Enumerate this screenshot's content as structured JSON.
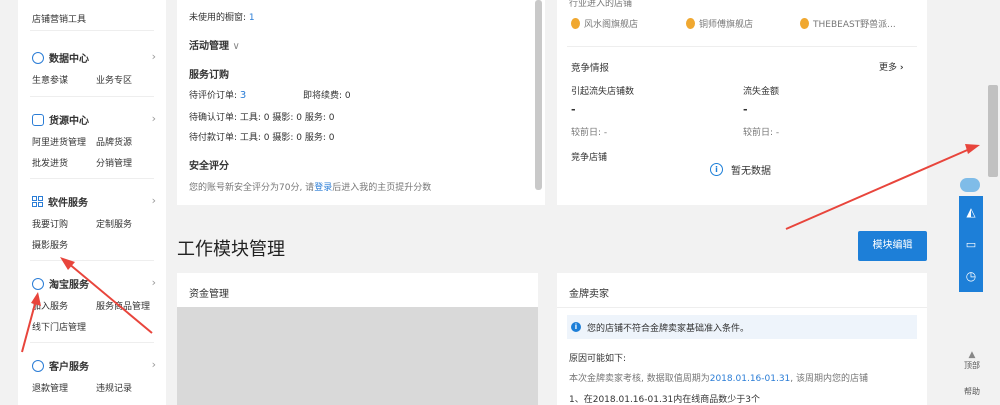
{
  "sidebar": {
    "top_item": "店铺营销工具",
    "sections": [
      {
        "title": "数据中心",
        "links": [
          "生意参谋",
          "业务专区"
        ]
      },
      {
        "title": "货源中心",
        "links": [
          "阿里进货管理",
          "品牌货源",
          "批发进货",
          "分销管理"
        ]
      },
      {
        "title": "软件服务",
        "links": [
          "我要订购",
          "定制服务",
          "摄影服务"
        ]
      },
      {
        "title": "淘宝服务",
        "links": [
          "加入服务",
          "服务商品管理",
          "线下门店管理"
        ]
      },
      {
        "title": "客户服务",
        "links": [
          "退款管理",
          "违规记录"
        ]
      }
    ]
  },
  "left_panel": {
    "unused_window": "未使用的橱窗:",
    "unused_window_count": "1",
    "activity": "活动管理",
    "service_order": "服务订购",
    "pending_review": "待评价订单:",
    "pending_review_count": "3",
    "expiring": "即将续费: 0",
    "pending_confirm": "待确认订单: 工具: 0  摄影: 0  服务: 0",
    "pending_payment": "待付款订单: 工具: 0  摄影: 0  服务: 0",
    "security": "安全评分",
    "security_text_pre": "您的账号新安全评分为70分, 请",
    "security_login": "登录",
    "security_text_post": "后进入我的主页提升分数"
  },
  "right_panel": {
    "partial_header": "行业进入的店铺",
    "shops": [
      "风水阁旗舰店",
      "铜师傅旗舰店",
      "THEBEAST野兽派..."
    ],
    "competition_title": "竞争情报",
    "more": "更多",
    "lost_shops_label": "引起流失店铺数",
    "lost_amount_label": "流失金额",
    "dash": "-",
    "compare_prev": "较前日: -",
    "competitor_shops": "竞争店铺",
    "no_data": "暂无数据"
  },
  "module": {
    "title": "工作模块管理",
    "edit_button": "模块编辑",
    "fund_mgmt": "资金管理",
    "gold_seller": "金牌卖家",
    "notice": "您的店铺不符合金牌卖家基础准入条件。",
    "reason_title": "原因可能如下:",
    "reason_line1_pre": "本次金牌卖家考核, 数据取值周期为",
    "reason_line1_date": "2018.01.16-01.31",
    "reason_line1_post": ", 该周期内您的店铺",
    "reason_line2": "1、在2018.01.16-01.31内在线商品数少于3个"
  },
  "floating": {
    "top_label": "顶部",
    "help_label": "帮助"
  }
}
